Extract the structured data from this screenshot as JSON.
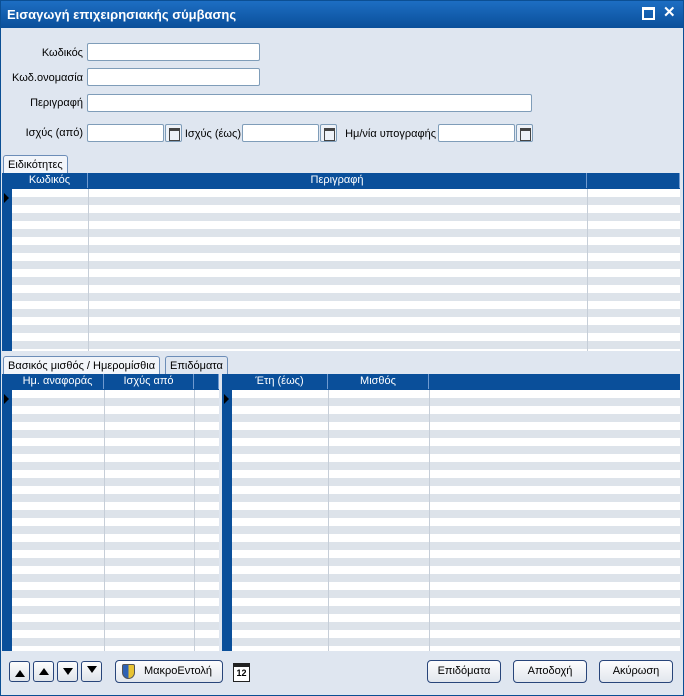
{
  "window": {
    "title": "Εισαγωγή επιχειρησιακής σύμβασης"
  },
  "form": {
    "code_label": "Κωδικός",
    "code_value": "",
    "name_label": "Κωδ.ονομασία",
    "name_value": "",
    "desc_label": "Περιγραφή",
    "desc_value": "",
    "valid_from_label": "Ισχύς (από)",
    "valid_from_value": "",
    "valid_to_label": "Ισχύς (έως)",
    "valid_to_value": "",
    "sign_date_label": "Ημ/νία υπογραφής",
    "sign_date_value": ""
  },
  "specialties": {
    "tab_label": "Ειδικότητες",
    "columns": [
      "Κωδικός",
      "Περιγραφή",
      ""
    ]
  },
  "salary": {
    "tabs": [
      "Βασικός μισθός / Ημερομίσθια",
      "Επιδόματα"
    ],
    "left_columns": [
      "Ημ. αναφοράς",
      "Ισχύς από",
      ""
    ],
    "right_columns": [
      "Έτη (έως)",
      "Μισθός",
      ""
    ]
  },
  "footer": {
    "macro_label": "ΜακροΕντολή",
    "calendar_day": "12",
    "allowances_label": "Επιδόματα",
    "accept_label": "Αποδοχή",
    "cancel_label": "Ακύρωση"
  },
  "icons": [
    "maximize-icon",
    "close-icon",
    "calendar-icon",
    "shield-icon",
    "first-record-icon",
    "previous-record-icon",
    "next-record-icon",
    "last-record-icon"
  ]
}
